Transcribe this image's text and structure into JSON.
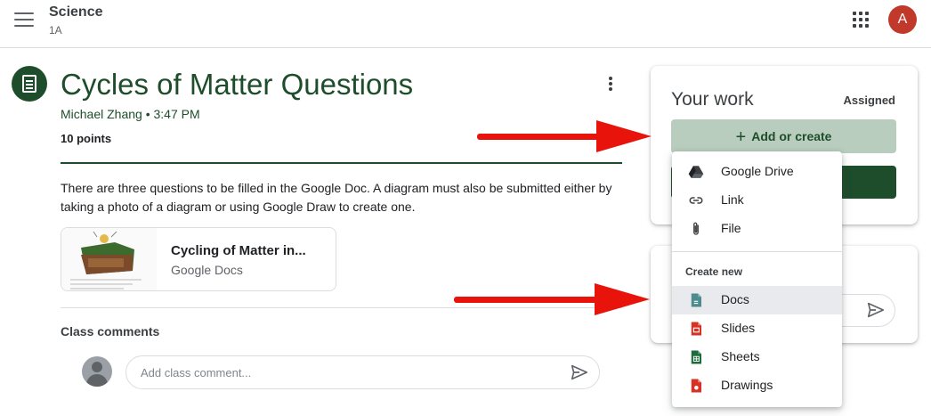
{
  "header": {
    "class_name": "Science",
    "class_section": "1A",
    "avatar_initial": "A"
  },
  "assignment": {
    "title": "Cycles of Matter Questions",
    "author_time": "Michael Zhang • 3:47 PM",
    "points": "10 points",
    "description": "There are three questions to be filled in the Google Doc. A diagram must also be submitted either by taking a photo of a diagram or using Google Draw to create one.",
    "attachment": {
      "title": "Cycling of Matter in...",
      "type": "Google Docs"
    }
  },
  "comments": {
    "label": "Class comments",
    "placeholder": "Add class comment..."
  },
  "your_work": {
    "title": "Your work",
    "status": "Assigned",
    "add_label": "Add or create"
  },
  "menu": {
    "items": [
      {
        "label": "Google Drive",
        "icon": "google-drive-icon"
      },
      {
        "label": "Link",
        "icon": "link-icon"
      },
      {
        "label": "File",
        "icon": "paperclip-icon"
      }
    ],
    "section_label": "Create new",
    "create_items": [
      {
        "label": "Docs",
        "icon": "docs-icon",
        "color": "#4d8b8e"
      },
      {
        "label": "Slides",
        "icon": "slides-icon",
        "color": "#d93025"
      },
      {
        "label": "Sheets",
        "icon": "sheets-icon",
        "color": "#1e6b3c"
      },
      {
        "label": "Drawings",
        "icon": "drawings-icon",
        "color": "#d93025"
      }
    ]
  },
  "colors": {
    "brand_green": "#1e4d2b",
    "add_button_bg": "#b8cdbd",
    "avatar_red": "#c0392b",
    "arrow_red": "#e8140c"
  }
}
